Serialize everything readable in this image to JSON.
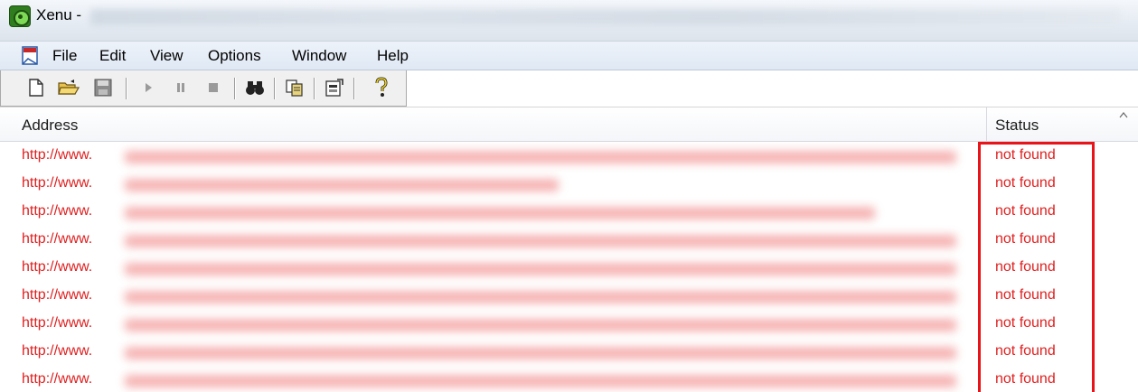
{
  "window": {
    "title": "Xenu -",
    "app_icon": "xenu-app-icon"
  },
  "menu": {
    "items": [
      "File",
      "Edit",
      "View",
      "Options",
      "Window",
      "Help"
    ]
  },
  "toolbar": {
    "buttons": [
      {
        "icon": "new-document-icon"
      },
      {
        "icon": "open-folder-icon"
      },
      {
        "icon": "save-icon"
      },
      {
        "icon": "play-icon"
      },
      {
        "icon": "pause-icon"
      },
      {
        "icon": "stop-icon"
      },
      {
        "icon": "find-binoculars-icon"
      },
      {
        "icon": "copy-icon"
      },
      {
        "icon": "properties-icon"
      },
      {
        "icon": "help-icon"
      }
    ]
  },
  "table": {
    "columns": [
      "Address",
      "Status"
    ],
    "rows": [
      {
        "address": "http://www.",
        "status": "not found"
      },
      {
        "address": "http://www.",
        "status": "not found"
      },
      {
        "address": "http://www.",
        "status": "not found"
      },
      {
        "address": "http://www.",
        "status": "not found"
      },
      {
        "address": "http://www.",
        "status": "not found"
      },
      {
        "address": "http://www.",
        "status": "not found"
      },
      {
        "address": "http://www.",
        "status": "not found"
      },
      {
        "address": "http://www.",
        "status": "not found"
      },
      {
        "address": "http://www.",
        "status": "not found"
      }
    ]
  },
  "colors": {
    "error_text": "#e02020",
    "highlight_box": "#e8141a"
  }
}
